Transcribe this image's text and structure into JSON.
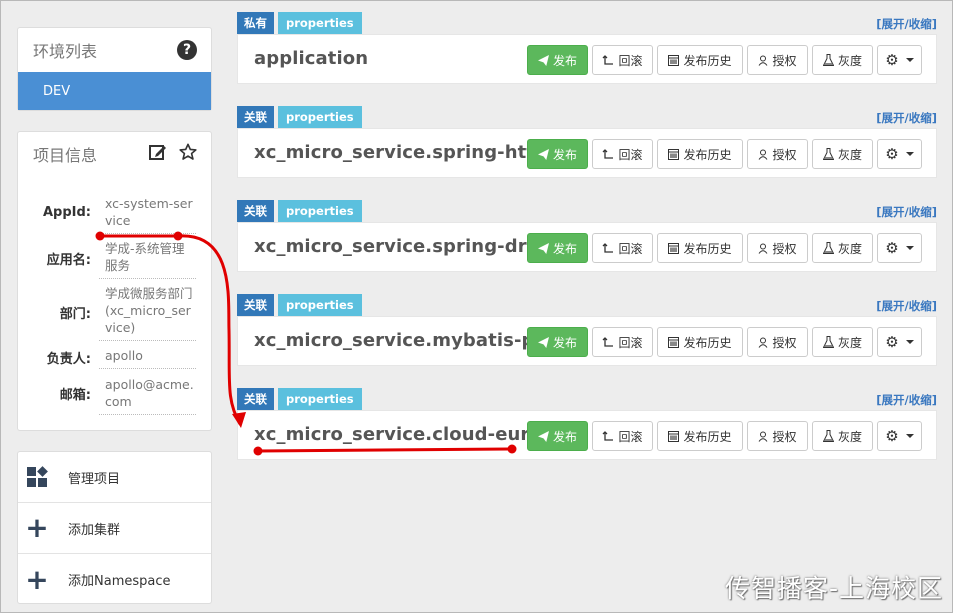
{
  "sidebar": {
    "env_panel": {
      "title": "环境列表",
      "items": [
        "DEV"
      ]
    },
    "info_panel": {
      "title": "项目信息",
      "rows": [
        {
          "key": "AppId:",
          "value": "xc-system-service"
        },
        {
          "key": "应用名:",
          "value": "学成-系统管理服务"
        },
        {
          "key": "部门:",
          "value": "学成微服务部门(xc_micro_service)"
        },
        {
          "key": "负责人:",
          "value": "apollo"
        },
        {
          "key": "邮箱:",
          "value": "apollo@acme.com"
        }
      ]
    },
    "actions": [
      {
        "label": "管理项目",
        "icon": "grid-icon"
      },
      {
        "label": "添加集群",
        "icon": "plus-icon"
      },
      {
        "label": "添加Namespace",
        "icon": "plus-icon"
      }
    ]
  },
  "namespaces": [
    {
      "type": "私有",
      "format": "properties",
      "name": "application"
    },
    {
      "type": "关联",
      "format": "properties",
      "name": "xc_micro_service.spring-http"
    },
    {
      "type": "关联",
      "format": "properties",
      "name": "xc_micro_service.spring-druid"
    },
    {
      "type": "关联",
      "format": "properties",
      "name": "xc_micro_service.mybatis-plus"
    },
    {
      "type": "关联",
      "format": "properties",
      "name": "xc_micro_service.cloud-eureka"
    }
  ],
  "namespace_toggle": "[展开/收缩]",
  "buttons": {
    "publish": "发布",
    "rollback": "回滚",
    "history": "发布历史",
    "auth": "授权",
    "gray": "灰度"
  },
  "colors": {
    "primary": "#4a8fd4",
    "success": "#5cb85c",
    "info": "#5bc0de",
    "annotation": "#e00000"
  },
  "watermark": "传智播客-上海校区"
}
